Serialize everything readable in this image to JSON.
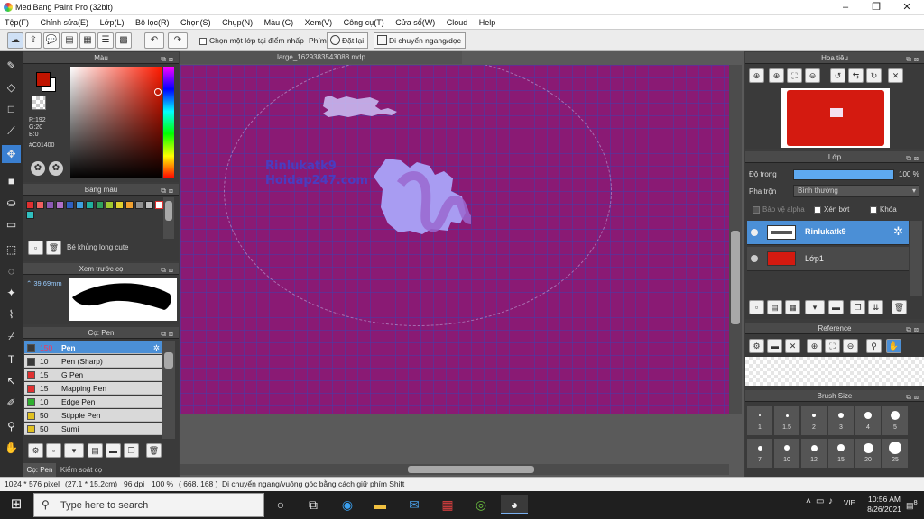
{
  "app": {
    "title": "MediBang Paint Pro (32bit)"
  },
  "menu": [
    "Tệp(F)",
    "Chỉnh sửa(E)",
    "Lớp(L)",
    "Bộ lọc(R)",
    "Chọn(S)",
    "Chụp(N)",
    "Màu (C)",
    "Xem(V)",
    "Công cụ(T)",
    "Cửa sổ(W)",
    "Cloud",
    "Help"
  ],
  "toolbar": {
    "select_layer_label": "Chọn một lớp tại điểm nhấp",
    "key_label": "Phím",
    "reset_label": "Đặt lại",
    "move_label": "Di chuyển ngang/dọc"
  },
  "document": {
    "tab_name": "large_1629383543088.mdp"
  },
  "canvas": {
    "text_line1": "Rinlukatk9",
    "text_line2": "Hoidap247.com"
  },
  "color_panel": {
    "title": "Màu",
    "r": "R:192",
    "g": "G:20",
    "b": "B:0",
    "hex": "#C01400",
    "fg": "#c01400",
    "bg": "#ffffff"
  },
  "palette_panel": {
    "title": "Bảng màu",
    "palette_name": "Bé khủng long cute",
    "swatches": [
      "#e03030",
      "#f06060",
      "#8c5ab4",
      "#b070c8",
      "#3060c0",
      "#40a0e0",
      "#20b0a0",
      "#30a060",
      "#a0c830",
      "#e0d030",
      "#f0a030",
      "#909090",
      "#c0c0c0",
      "#ffffff",
      "#30c0c0"
    ]
  },
  "preview_panel": {
    "title": "Xem trước cọ",
    "size": "39.69mm"
  },
  "brush_panel": {
    "title": "Cọ: Pen",
    "items": [
      {
        "size": "150",
        "name": "Pen",
        "color": "#3a3a3a"
      },
      {
        "size": "10",
        "name": "Pen (Sharp)",
        "color": "#3a3a3a"
      },
      {
        "size": "15",
        "name": "G Pen",
        "color": "#e03030"
      },
      {
        "size": "15",
        "name": "Mapping Pen",
        "color": "#e03030"
      },
      {
        "size": "10",
        "name": "Edge Pen",
        "color": "#30b030"
      },
      {
        "size": "50",
        "name": "Stipple Pen",
        "color": "#e0c020"
      },
      {
        "size": "50",
        "name": "Sumi",
        "color": "#e0c020"
      }
    ],
    "tab1": "Cọ: Pen",
    "tab2": "Kiểm soát cọ"
  },
  "navigator_panel": {
    "title": "Hoa tiêu"
  },
  "layer_panel": {
    "title": "Lớp",
    "opacity_label": "Độ trong",
    "opacity_value": "100 %",
    "blend_label": "Pha trộn",
    "blend_value": "Bình thường",
    "alpha_protect": "Bảo vệ alpha",
    "clipping": "Xén bớt",
    "lock": "Khóa",
    "layers": [
      {
        "name": "Rinlukatk9",
        "selected": true
      },
      {
        "name": "Lớp1",
        "selected": false
      }
    ]
  },
  "reference_panel": {
    "title": "Reference"
  },
  "brushsize_panel": {
    "title": "Brush Size",
    "row1": [
      "1",
      "1.5",
      "2",
      "3",
      "4",
      "5"
    ],
    "row2": [
      "7",
      "10",
      "12",
      "15",
      "20",
      "25"
    ]
  },
  "status": {
    "size": "1024 * 576 pixel",
    "dims": "(27.1 * 15.2cm)",
    "dpi": "96 dpi",
    "zoom": "100 %",
    "coords": "( 668, 168 )",
    "hint": "Di chuyển ngang/vuông góc bằng cách giữ phím Shift"
  },
  "taskbar": {
    "search_placeholder": "Type here to search",
    "lang": "VIE",
    "time": "10:56 AM",
    "date": "8/26/2021",
    "notifications": "8"
  }
}
